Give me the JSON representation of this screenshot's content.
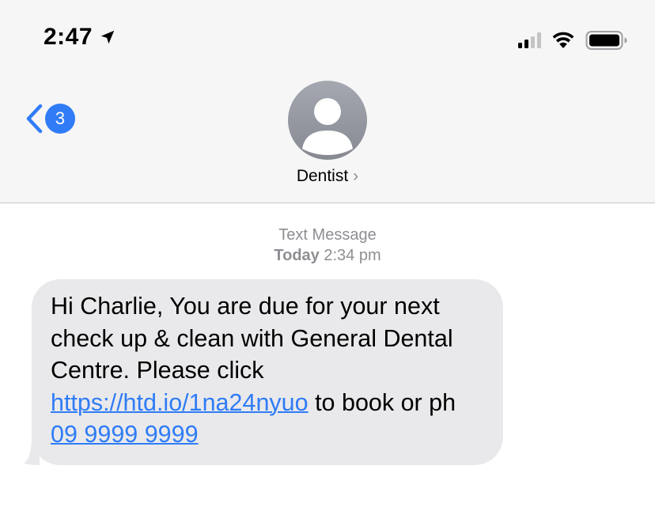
{
  "status_bar": {
    "time": "2:47",
    "icons": [
      "location-arrow-icon",
      "cellular-signal-icon",
      "wifi-icon",
      "battery-icon"
    ]
  },
  "header": {
    "back_badge_count": "3",
    "contact_name": "Dentist",
    "contact_chevron": "›"
  },
  "conversation": {
    "message_type": "Text Message",
    "day": "Today",
    "time": "2:34 pm",
    "message": {
      "text_before_link": "Hi Charlie, You are due for your next check up & clean with General Dental Centre. Please click ",
      "link": "https://htd.io/1na24nyuo",
      "text_middle": " to book or ph ",
      "phone": "09 9999 9999"
    }
  },
  "colors": {
    "link_blue": "#2f7cf6",
    "bubble_gray": "#e9e9eb",
    "header_bg": "#f6f6f6",
    "meta_gray": "#8e8e93"
  }
}
